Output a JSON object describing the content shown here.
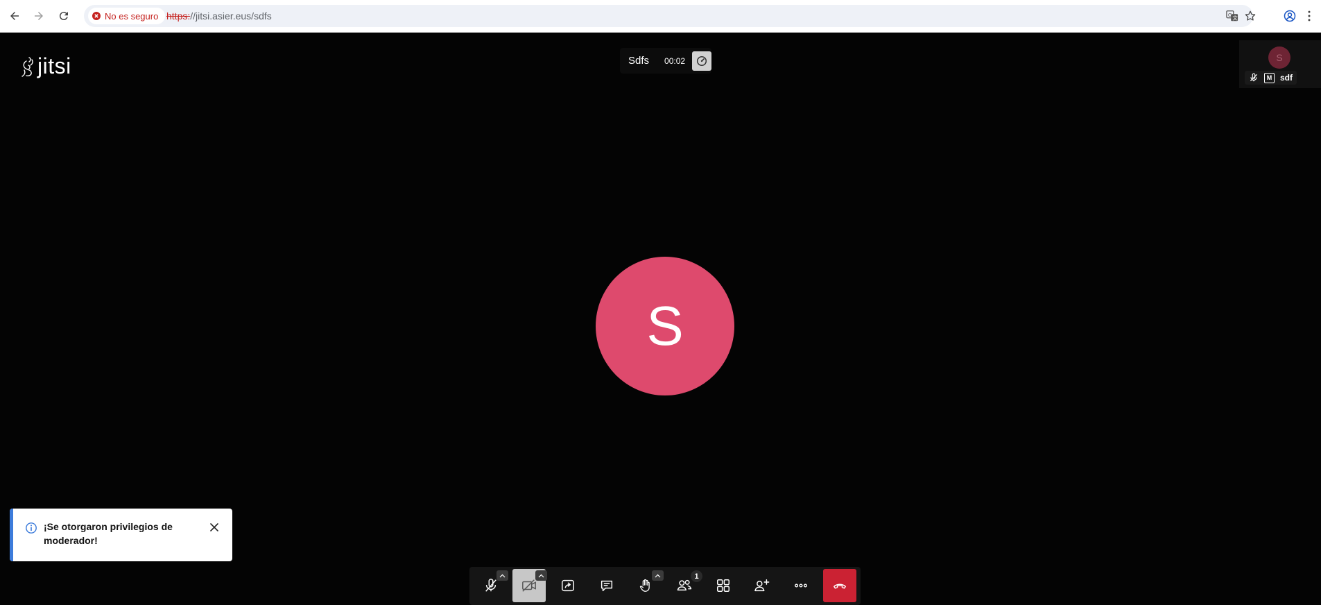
{
  "browser": {
    "security_label": "No es seguro",
    "url_scheme": "https:",
    "url_rest": "//jitsi.asier.eus/sdfs"
  },
  "meeting": {
    "logo_text": "jitsi",
    "subject": "Sdfs",
    "timer": "00:02",
    "local_avatar_initial": "S",
    "thumbnail": {
      "avatar_initial": "S",
      "moderator_badge": "M",
      "display_name": "sdf"
    }
  },
  "notification": {
    "text": "¡Se otorgaron privilegios de moderador!"
  },
  "toolbar": {
    "participants_count": "1"
  },
  "colors": {
    "avatar": "#de4a6d",
    "hangup": "#cb2233",
    "notification_accent": "#3d7cdb",
    "insecure_red": "#c5221f"
  }
}
